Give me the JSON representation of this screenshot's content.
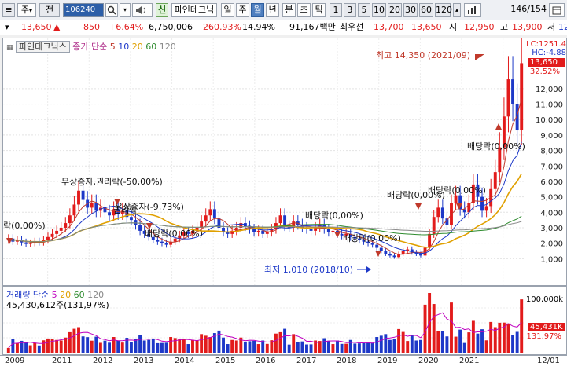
{
  "toolbar": {
    "icon_menu": "≡",
    "market_select": "주",
    "market_arrow": "▾",
    "period_select": "전",
    "stock_code": "106240",
    "search_icon": "search-icon",
    "sound_icon": "speaker-icon",
    "new_badge": "신",
    "stock_name": "파인테크닉",
    "period_tabs": [
      "일",
      "주",
      "월",
      "년",
      "분",
      "초",
      "틱"
    ],
    "active_period": "월",
    "interval_buttons": [
      "1",
      "3",
      "5",
      "10",
      "20",
      "30",
      "60",
      "120"
    ],
    "page_current": "146",
    "page_total": "/154"
  },
  "quote": {
    "price": "13,650",
    "change_arrow": "▲",
    "change": "850",
    "change_rate": "+6.64%",
    "volume": "6,750,006",
    "volume_rate": "260.93%",
    "turnover": "14.94%",
    "amount": "91,167백만",
    "best_ask_label": "최우선",
    "best_ask": "13,700",
    "best_bid": "13,650",
    "open_label": "시",
    "open": "12,950",
    "high_label": "고",
    "high": "13,900",
    "low_label": "저",
    "low": "12"
  },
  "price_pane": {
    "legend_tag": "파인테크닉스",
    "legend_ma_label": "종가 단순",
    "legend_ma": [
      {
        "label": "5",
        "color": "#c0392b"
      },
      {
        "label": "10",
        "color": "#1d38c8"
      },
      {
        "label": "20",
        "color": "#e0a000"
      },
      {
        "label": "60",
        "color": "#2e8b2e"
      },
      {
        "label": "120",
        "color": "#888888"
      }
    ],
    "right_labels": {
      "lc": "LC:1251.4",
      "hc": "HC:-4.88",
      "current": "13,650",
      "pct": "32.52%"
    },
    "y_ticks": [
      "12,000",
      "11,000",
      "10,000",
      "9,000",
      "8,000",
      "7,000",
      "6,000",
      "5,000",
      "4,000",
      "3,000",
      "2,000",
      "1,000"
    ],
    "annotations": {
      "high": "최고 14,350 (2021/09)",
      "low": "최저 1,010 (2018/10)",
      "a1": "무상증자,권리락(-50,00%)",
      "a2": "유상증자(-9,73%)",
      "a3": "권리락",
      "a4": "배당락(0,00%)",
      "a5": "배당락(0,00%)",
      "a6": "배당락(0,00%)",
      "a7": "배당락(0,00%)",
      "a8": "배당락(0,00%)",
      "a9": "배당락(0,00%)",
      "left_edge": "락(0,00%)"
    }
  },
  "vol_pane": {
    "legend_label": "거래량",
    "legend_ma_label": "단순",
    "legend_ma": [
      {
        "label": "5",
        "color": "#c000c0"
      },
      {
        "label": "20",
        "color": "#e0a000"
      },
      {
        "label": "60",
        "color": "#2e8b2e"
      },
      {
        "label": "120",
        "color": "#888888"
      }
    ],
    "legend_value": "45,430,612주(131,97%)",
    "right_labels": {
      "tick": "100,000k",
      "current": "45,431K",
      "pct": "131.97%"
    }
  },
  "date_axis": [
    "2009",
    "2011",
    "2012",
    "2013",
    "2014",
    "2015",
    "2016",
    "2017",
    "2018",
    "2019",
    "2020",
    "2021",
    "12/01"
  ],
  "colors": {
    "up": "#e21b1b",
    "down": "#1d38c8",
    "accent": "#4f7fbf"
  },
  "chart_data": {
    "type": "candlestick",
    "frequency": "monthly",
    "ylim": [
      0,
      13650
    ],
    "series": [
      {
        "name": "close",
        "values": [
          2300,
          2100,
          2200,
          2050,
          1950,
          2000,
          2100,
          2050,
          2200,
          2400,
          2600,
          2800,
          3000,
          3300,
          3800,
          4500,
          5400,
          4800,
          4300,
          4600,
          4100,
          4300,
          4000,
          3800,
          4200,
          3900,
          4100,
          3700,
          3500,
          3200,
          2800,
          2600,
          2400,
          2200,
          2100,
          2000,
          1900,
          2100,
          2300,
          2500,
          2700,
          2600,
          2800,
          3000,
          3400,
          3800,
          4200,
          3600,
          3000,
          2700,
          2600,
          2800,
          3000,
          3300,
          3100,
          2900,
          2700,
          2800,
          2600,
          2700,
          2900,
          3300,
          3800,
          3100,
          3000,
          3400,
          3200,
          3000,
          2900,
          2800,
          3000,
          3200,
          2900,
          2700,
          2800,
          2600,
          2500,
          2600,
          2400,
          2300,
          2200,
          2100,
          2000,
          1900,
          1700,
          1500,
          1300,
          1200,
          1100,
          1300,
          1500,
          1600,
          1400,
          1300,
          1200,
          1700,
          2600,
          3700,
          4300,
          3600,
          3200,
          4600,
          5100,
          4200,
          4000,
          4600,
          5800,
          5000,
          4100,
          4400,
          5500,
          6600,
          8200,
          10200,
          12600,
          11000,
          9300,
          13650
        ]
      }
    ],
    "annotations": [
      "최고 14,350 (2021/09)",
      "최저 1,010 (2018/10)"
    ]
  }
}
